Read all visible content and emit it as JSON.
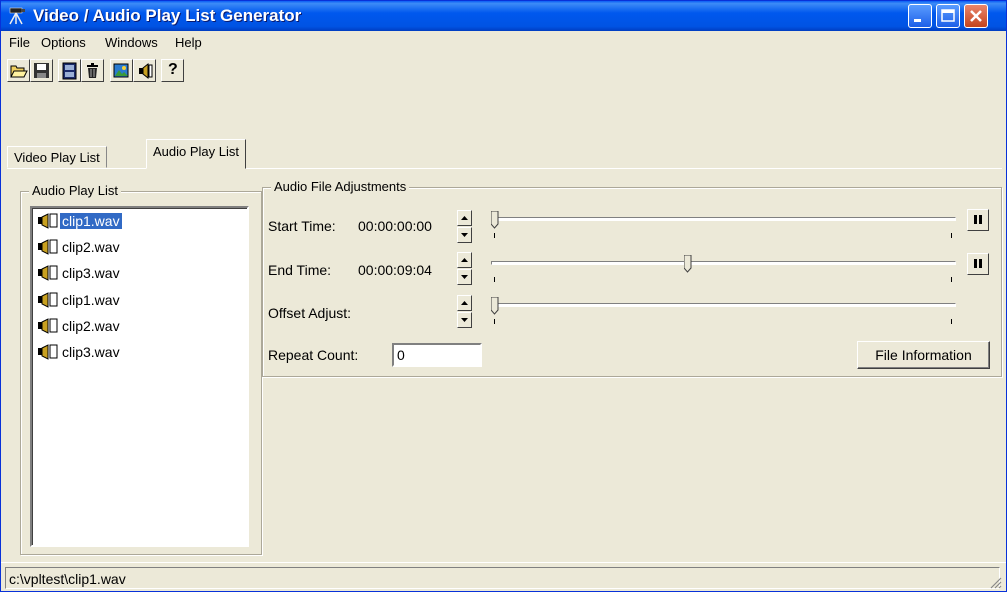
{
  "window": {
    "title": "Video / Audio Play List Generator"
  },
  "menu": [
    "File",
    "Options",
    "Windows",
    "Help"
  ],
  "toolbar": [
    {
      "icon": "open-folder-icon"
    },
    {
      "icon": "save-icon"
    },
    {
      "icon": "video-clip-icon"
    },
    {
      "icon": "trash-icon"
    },
    {
      "icon": "picture-icon"
    },
    {
      "icon": "speaker-icon"
    },
    {
      "icon": "help-icon",
      "label": "?"
    }
  ],
  "tabs": [
    {
      "label": "Video Play List",
      "active": false
    },
    {
      "label": "Audio Play List",
      "active": true
    }
  ],
  "playlist": {
    "title": "Audio Play List",
    "items": [
      {
        "label": "clip1.wav",
        "selected": true
      },
      {
        "label": "clip2.wav",
        "selected": false
      },
      {
        "label": "clip3.wav",
        "selected": false
      },
      {
        "label": "clip1.wav",
        "selected": false
      },
      {
        "label": "clip2.wav",
        "selected": false
      },
      {
        "label": "clip3.wav",
        "selected": false
      }
    ]
  },
  "adjust": {
    "title": "Audio File Adjustments",
    "start_label": "Start Time:",
    "start_value": "00:00:00:00",
    "start_position": 0,
    "end_label": "End Time:",
    "end_value": "00:00:09:04",
    "end_position": 0.42,
    "offset_label": "Offset Adjust:",
    "offset_position": 0,
    "repeat_label": "Repeat Count:",
    "repeat_value": "0",
    "file_info_button": "File Information"
  },
  "status": {
    "path": "c:\\vpltest\\clip1.wav"
  },
  "colors": {
    "titlebar": "#0054e3",
    "selection": "#316ac5",
    "close_button": "#d05a34",
    "face": "#ece9d8"
  }
}
